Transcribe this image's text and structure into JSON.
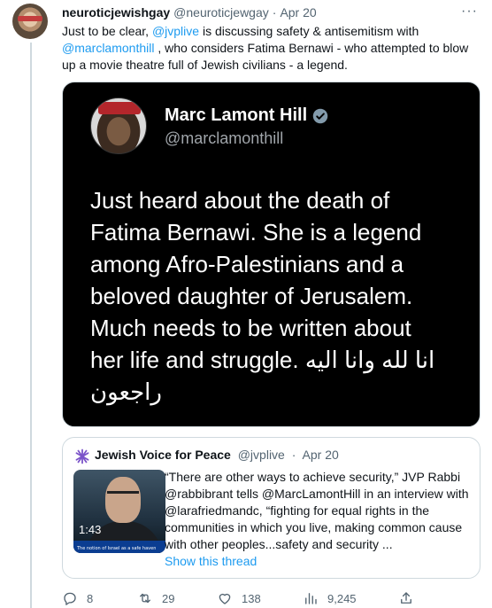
{
  "tweet": {
    "author": {
      "display_name": "neuroticjewishgay",
      "handle": "@neuroticjewgay",
      "date": "Apr 20"
    },
    "separator": "·",
    "more_label": "···",
    "text": {
      "part1": "Just to be clear, ",
      "mention1": "@jvplive",
      "part2": " is discussing safety & antisemitism with ",
      "mention2": "@marclamonthill",
      "part3": " , who considers Fatima Bernawi - who attempted to blow up a movie theatre full of Jewish civilians - a legend."
    }
  },
  "embedded_image": {
    "name": "Marc Lamont Hill",
    "handle": "@marclamonthill",
    "lines": [
      "Just heard about the death of",
      "Fatima Bernawi. She is a legend",
      "among Afro-Palestinians and a",
      "beloved daughter of Jerusalem.",
      "Much needs to be written about"
    ],
    "line6_en": "her life and struggle.",
    "line6_ar": "انا لله وانا اليه",
    "line7_ar": "راجعون"
  },
  "quote": {
    "name": "Jewish Voice for Peace",
    "handle": "@jvplive",
    "date": "Apr 20",
    "separator": "·",
    "thumbnail_caption": "The notion of Israel as a safe haven",
    "video_duration": "1:43",
    "text": "“There are other ways to achieve security,” JVP Rabbi @rabbibrant tells @MarcLamontHill in an interview with @larafriedmandc, “fighting for equal rights in the communities in which you live, making common cause with other peoples...safety and security ...",
    "show_thread": "Show this thread"
  },
  "actions": {
    "reply": {
      "icon": "reply-icon",
      "count": "8"
    },
    "retweet": {
      "icon": "retweet-icon",
      "count": "29"
    },
    "like": {
      "icon": "heart-icon",
      "count": "138"
    },
    "views": {
      "icon": "views-icon",
      "count": "9,245"
    },
    "share": {
      "icon": "share-icon"
    }
  },
  "colors": {
    "link": "#1d9bf0",
    "muted": "#536471",
    "text": "#0f1419",
    "verified": "#829aab"
  }
}
